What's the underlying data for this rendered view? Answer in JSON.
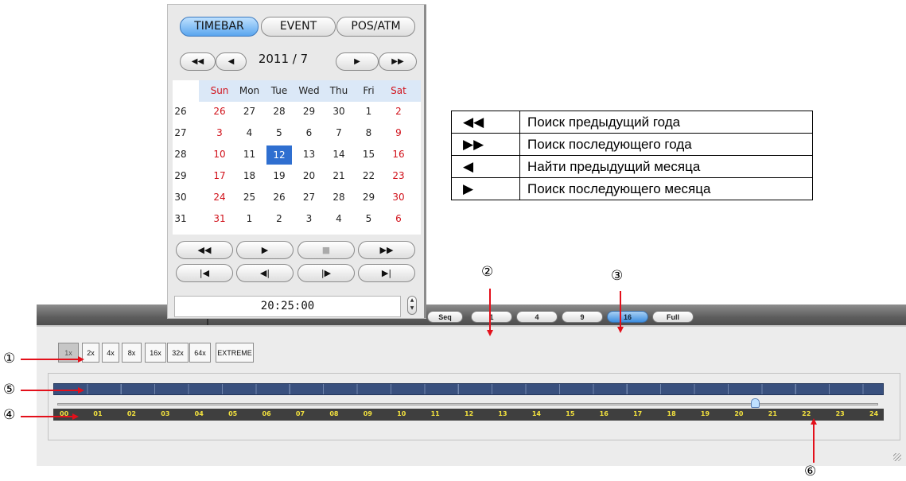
{
  "calendar": {
    "tabs": [
      "TIMEBAR",
      "EVENT",
      "POS/ATM"
    ],
    "month_label": "2011 / 7",
    "weekday_headers": [
      "Sun",
      "Mon",
      "Tue",
      "Wed",
      "Thu",
      "Fri",
      "Sat"
    ],
    "week_numbers": [
      "26",
      "27",
      "28",
      "29",
      "30",
      "31"
    ],
    "days": [
      [
        "26",
        "27",
        "28",
        "29",
        "30",
        "1",
        "2"
      ],
      [
        "3",
        "4",
        "5",
        "6",
        "7",
        "8",
        "9"
      ],
      [
        "10",
        "11",
        "12",
        "13",
        "14",
        "15",
        "16"
      ],
      [
        "17",
        "18",
        "19",
        "20",
        "21",
        "22",
        "23"
      ],
      [
        "24",
        "25",
        "26",
        "27",
        "28",
        "29",
        "30"
      ],
      [
        "31",
        "1",
        "2",
        "3",
        "4",
        "5",
        "6"
      ]
    ],
    "selected_day": "12",
    "time": "20:25:00",
    "icons": {
      "prev_year": "double-left-triangle-icon",
      "prev_month": "left-triangle-icon",
      "next_month": "right-triangle-icon",
      "next_year": "double-right-triangle-icon",
      "rewind": "rewind-icon",
      "play": "play-icon",
      "stop": "stop-icon",
      "fast_forward": "fast-forward-icon",
      "skip_start": "skip-to-start-icon",
      "step_back": "step-back-icon",
      "step_forward": "step-forward-icon",
      "skip_end": "skip-to-end-icon"
    }
  },
  "layout_buttons": [
    "Seq",
    "1",
    "4",
    "9",
    "16",
    "Full"
  ],
  "active_layout": "16",
  "speeds": [
    "1x",
    "2x",
    "4x",
    "8x",
    "16x",
    "32x",
    "64x",
    "EXTREME"
  ],
  "selected_speed": "1x",
  "timeline": {
    "hours": [
      "00",
      "01",
      "02",
      "03",
      "04",
      "05",
      "06",
      "07",
      "08",
      "09",
      "10",
      "11",
      "12",
      "13",
      "14",
      "15",
      "16",
      "17",
      "18",
      "19",
      "20",
      "21",
      "22",
      "23",
      "24"
    ],
    "playhead_hour": 20.4
  },
  "legend": [
    {
      "symbol": "◀◀",
      "text": "Поиск предыдущий года"
    },
    {
      "symbol": "▶▶",
      "text": "Поиск последующего года"
    },
    {
      "symbol": "◀",
      "text": "Найти предыдущий месяца"
    },
    {
      "symbol": "▶",
      "text": "Поиск последующего месяца"
    }
  ],
  "markers": [
    "①",
    "②",
    "③",
    "④",
    "⑤",
    "⑥"
  ],
  "colors": {
    "accent": "#3d8ee0",
    "arrow": "#e3101b",
    "bar": "#39507e",
    "hour_text": "#f3e23e",
    "weekend": "#d1121b"
  }
}
